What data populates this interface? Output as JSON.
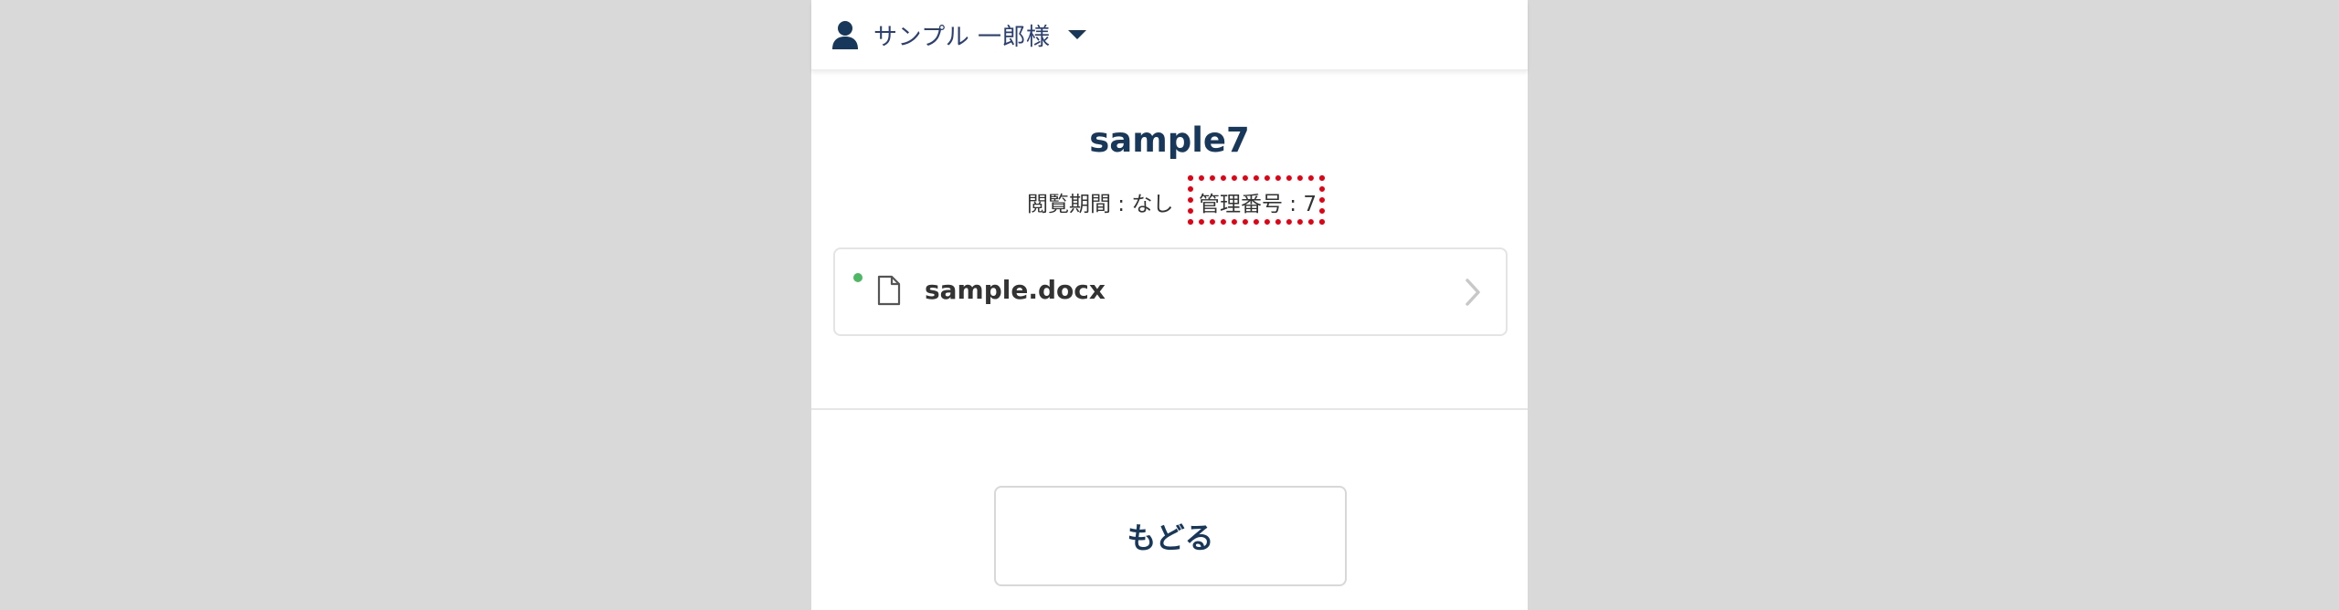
{
  "header": {
    "user_name": "サンプル 一郎様"
  },
  "document": {
    "title": "sample7",
    "meta_period": "閲覧期間 : なし",
    "meta_manage_number": "管理番号 : 7"
  },
  "files": [
    {
      "name": "sample.docx",
      "status_color": "#4cb862"
    }
  ],
  "actions": {
    "back_label": "もどる"
  },
  "colors": {
    "background": "#d9d9d9",
    "panel": "#ffffff",
    "title_text": "#17375b",
    "user_text": "#2a3f73",
    "highlight": "#e60012",
    "status_dot": "#4cb862"
  },
  "icons": {
    "user": "user-icon",
    "caret": "caret-down-icon",
    "file": "file-icon",
    "chevron": "chevron-right-icon"
  }
}
